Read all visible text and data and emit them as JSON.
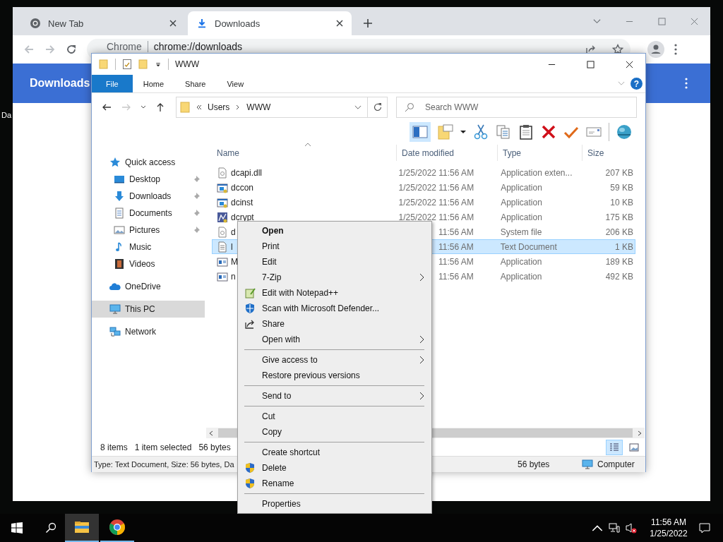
{
  "desktop": {
    "icon_label": "Da"
  },
  "browser": {
    "tabs": [
      {
        "label": "New Tab",
        "kind": "newtab",
        "selected": false
      },
      {
        "label": "Downloads",
        "kind": "downloads",
        "selected": true
      }
    ],
    "omnibox": {
      "site": "Chrome",
      "url": "chrome://downloads"
    },
    "page_title": "Downloads"
  },
  "explorer": {
    "title": "WWW",
    "ribbon_tabs": [
      {
        "label": "File",
        "kind": "backstage"
      },
      {
        "label": "Home",
        "kind": "tab"
      },
      {
        "label": "Share",
        "kind": "tab"
      },
      {
        "label": "View",
        "kind": "tab"
      }
    ],
    "help": "?",
    "breadcrumb": [
      "Users",
      "WWW"
    ],
    "search": {
      "placeholder": "Search WWW"
    },
    "navigation": [
      {
        "label": "Quick access",
        "kind": "quick",
        "selected": false,
        "children": [
          {
            "label": "Desktop",
            "kind": "desktop",
            "pinned": true,
            "selected": false
          },
          {
            "label": "Downloads",
            "kind": "downloads",
            "pinned": true,
            "selected": false
          },
          {
            "label": "Documents",
            "kind": "documents",
            "pinned": true,
            "selected": false
          },
          {
            "label": "Pictures",
            "kind": "pictures",
            "pinned": true,
            "selected": false
          },
          {
            "label": "Music",
            "kind": "music",
            "pinned": false,
            "selected": false
          },
          {
            "label": "Videos",
            "kind": "videos",
            "pinned": false,
            "selected": false
          }
        ]
      },
      {
        "label": "OneDrive",
        "kind": "cloud",
        "selected": false
      },
      {
        "label": "This PC",
        "kind": "pc",
        "selected": true
      },
      {
        "label": "Network",
        "kind": "network",
        "selected": false
      }
    ],
    "columns": [
      "Name",
      "Date modified",
      "Type",
      "Size"
    ],
    "files": [
      {
        "name": "dcapi.dll",
        "date": "1/25/2022 11:56 AM",
        "type": "Application exten...",
        "size": "207 KB",
        "kind": "config",
        "selected": false
      },
      {
        "name": "dccon",
        "date": "1/25/2022 11:56 AM",
        "type": "Application",
        "size": "59 KB",
        "kind": "app",
        "selected": false
      },
      {
        "name": "dcinst",
        "date": "1/25/2022 11:56 AM",
        "type": "Application",
        "size": "10 KB",
        "kind": "app",
        "selected": false
      },
      {
        "name": "dcrypt",
        "date": "1/25/2022 11:56 AM",
        "type": "Application",
        "size": "175 KB",
        "kind": "chart-app",
        "selected": false
      },
      {
        "name": "d",
        "date": "11:56 AM",
        "type": "System file",
        "size": "206 KB",
        "kind": "config",
        "selected": false
      },
      {
        "name": "l",
        "date": "11:56 AM",
        "type": "Text Document",
        "size": "1 KB",
        "kind": "text",
        "selected": true
      },
      {
        "name": "M",
        "date": "11:56 AM",
        "type": "Application",
        "size": "189 KB",
        "kind": "window",
        "selected": false
      },
      {
        "name": "n",
        "date": "11:56 AM",
        "type": "Application",
        "size": "492 KB",
        "kind": "window",
        "selected": false
      }
    ],
    "status": {
      "count": "8 items",
      "selection": "1 item selected",
      "size": "56 bytes"
    },
    "views": [
      {
        "kind": "details",
        "selected": true
      },
      {
        "kind": "thumbnails",
        "selected": false
      }
    ],
    "details": {
      "summary": "Type: Text Document, Size: 56 bytes, Da",
      "size": "56 bytes",
      "location": "Computer"
    }
  },
  "context_menu": [
    {
      "label": "Open",
      "kind": "default"
    },
    {
      "label": "Print",
      "kind": "plain"
    },
    {
      "label": "Edit",
      "kind": "plain"
    },
    {
      "label": "7-Zip",
      "kind": "submenu"
    },
    {
      "label": "Edit with Notepad++",
      "kind": "notepad"
    },
    {
      "label": "Scan with Microsoft Defender...",
      "kind": "defender"
    },
    {
      "label": "Share",
      "kind": "share"
    },
    {
      "label": "Open with",
      "kind": "submenu"
    },
    {
      "kind": "separator"
    },
    {
      "label": "Give access to",
      "kind": "submenu"
    },
    {
      "label": "Restore previous versions",
      "kind": "plain"
    },
    {
      "kind": "separator"
    },
    {
      "label": "Send to",
      "kind": "submenu"
    },
    {
      "kind": "separator"
    },
    {
      "label": "Cut",
      "kind": "plain"
    },
    {
      "label": "Copy",
      "kind": "plain"
    },
    {
      "kind": "separator"
    },
    {
      "label": "Create shortcut",
      "kind": "plain"
    },
    {
      "label": "Delete",
      "kind": "shield"
    },
    {
      "label": "Rename",
      "kind": "shield"
    },
    {
      "kind": "separator"
    },
    {
      "label": "Properties",
      "kind": "plain"
    }
  ],
  "taskbar": {
    "apps": [
      {
        "kind": "explorer",
        "selected": true
      },
      {
        "kind": "chrome",
        "selected": false
      }
    ],
    "time": "11:56 AM",
    "date": "1/25/2022"
  }
}
